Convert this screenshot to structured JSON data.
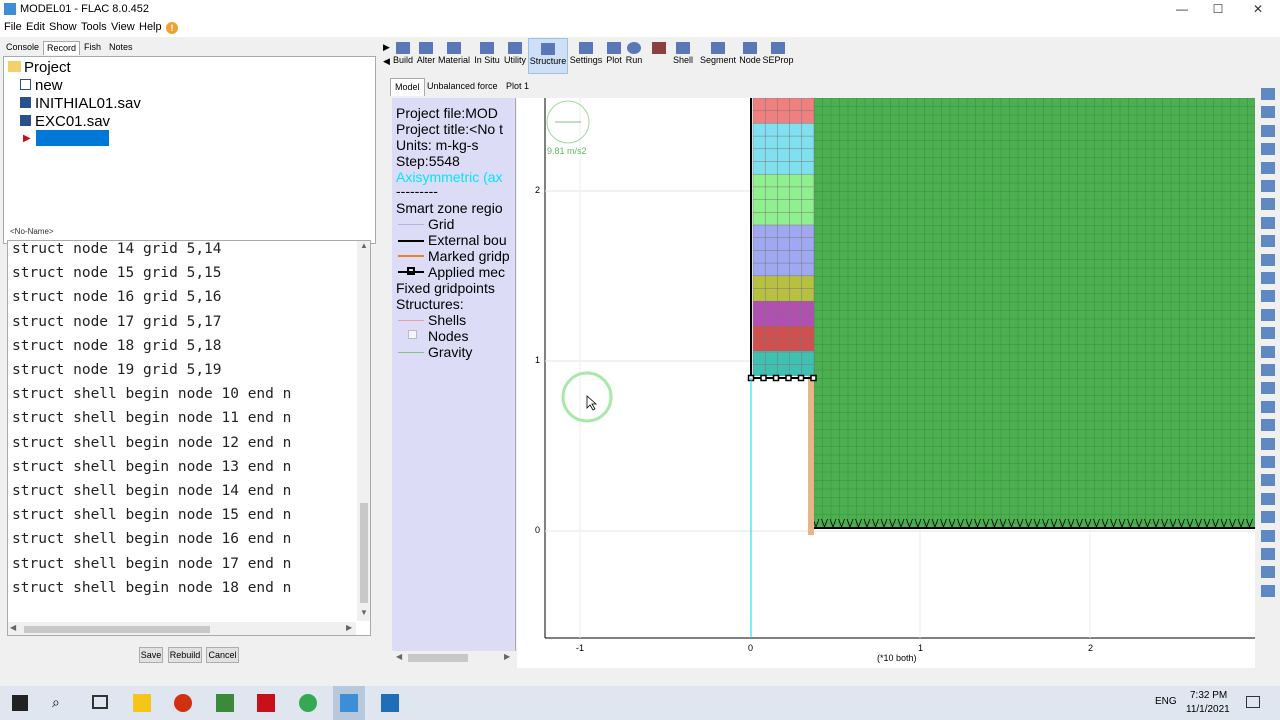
{
  "window": {
    "title": "MODEL01 - FLAC 8.0.452",
    "minimize": "—",
    "maximize": "☐",
    "close": "✕"
  },
  "menu": [
    "File",
    "Edit",
    "Show",
    "Tools",
    "View",
    "Help"
  ],
  "left_tabs": [
    "Console",
    "Record",
    "Fish",
    "Notes"
  ],
  "tree": {
    "root": "Project",
    "items": [
      "new",
      "INITHIAL01.sav",
      "EXC01.sav"
    ]
  },
  "record_name": "<No-Name>",
  "commands": [
    "struct node 14 grid 5,14",
    "struct node 15 grid 5,15",
    "struct node 16 grid 5,16",
    "struct node 17 grid 5,17",
    "struct node 18 grid 5,18",
    "struct node 19 grid 5,19",
    "struct shell begin node 10 end n",
    "struct shell begin node 11 end n",
    "struct shell begin node 12 end n",
    "struct shell begin node 13 end n",
    "struct shell begin node 14 end n",
    "struct shell begin node 15 end n",
    "struct shell begin node 16 end n",
    "struct shell begin node 17 end n",
    "struct shell begin node 18 end n"
  ],
  "buttons": {
    "save": "Save",
    "rebuild": "Rebuild",
    "cancel": "Cancel"
  },
  "toolbar": [
    "Build",
    "Alter",
    "Material",
    "In Situ",
    "Utility",
    "Structure",
    "Settings",
    "Plot",
    "Run",
    "",
    "Shell",
    "Segment",
    "Node",
    "SEProp"
  ],
  "view_tabs": [
    "Model",
    "Unbalanced force",
    "Plot 1"
  ],
  "legend": {
    "project_file": "Project file:MOD",
    "project_title": "Project title:<No t",
    "units": "Units: m-kg-s",
    "step": "Step:5548",
    "axisym": "Axisymmetric (ax",
    "sep": "---------",
    "smart": "Smart zone regio",
    "grid": "Grid",
    "external": "External bou",
    "marked": "Marked gridp",
    "applied": "Applied mec",
    "fixed": "Fixed gridpoints",
    "structures": "Structures:",
    "shells": "Shells",
    "nodes": "Nodes",
    "gravity": "Gravity"
  },
  "plot": {
    "gravity_label": "9.81 m/s2",
    "y_ticks": [
      "2",
      "1",
      "0"
    ],
    "x_ticks": [
      "-1",
      "0",
      "1",
      "2"
    ],
    "x_units": "(*10 both)"
  },
  "taskbar": {
    "lang": "ENG",
    "time": "7:32 PM",
    "date": "11/1/2021"
  },
  "colors": {
    "soil": "#4caf50",
    "legend_bg": "#dcdcf6",
    "accent": "#0078d7"
  }
}
